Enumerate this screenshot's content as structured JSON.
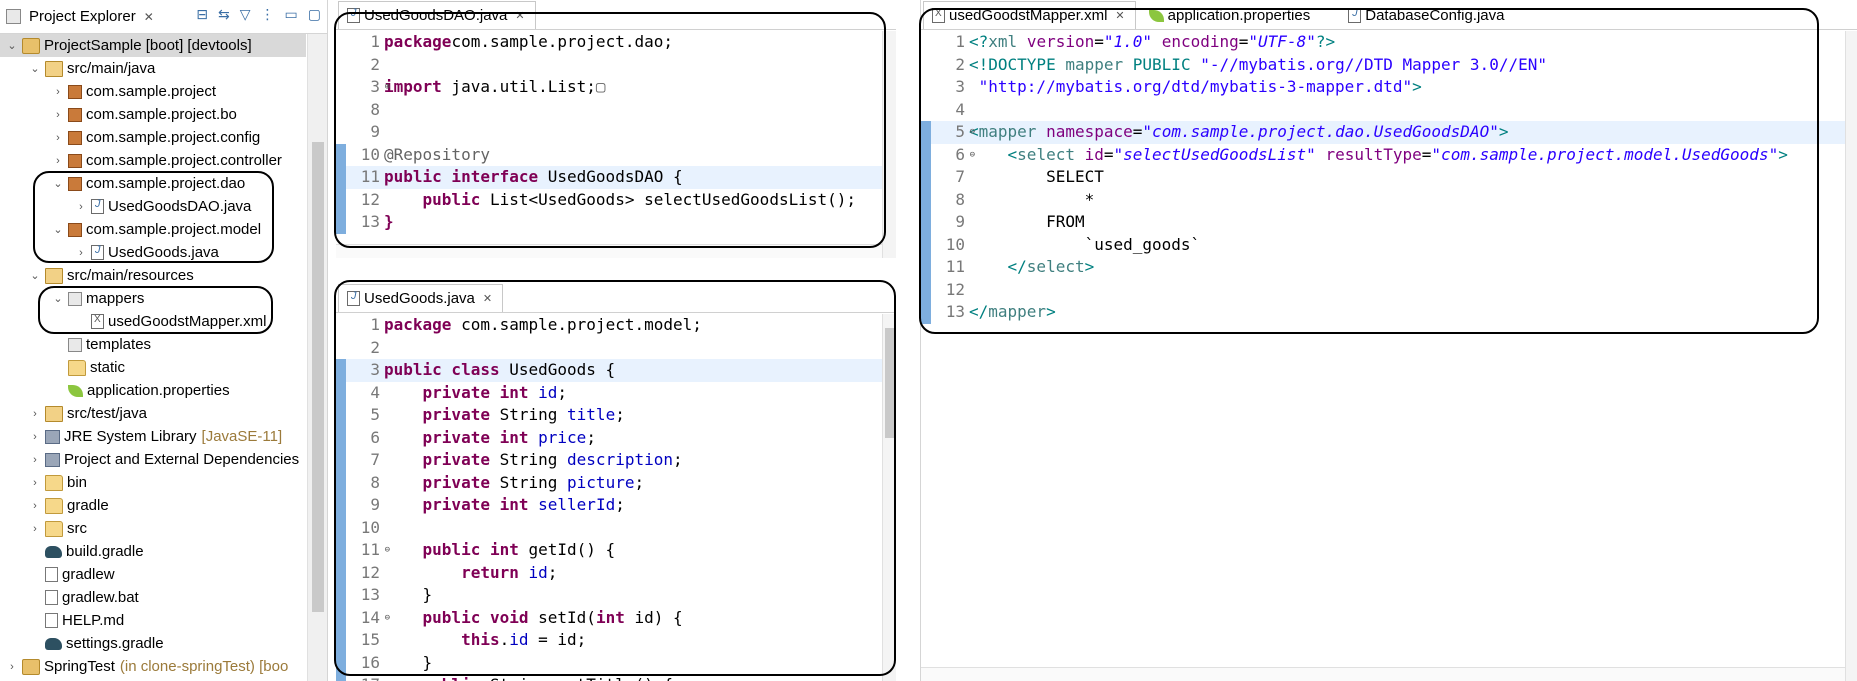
{
  "explorer": {
    "title": "Project Explorer",
    "tree": [
      {
        "label": "ProjectSample [boot] [devtools]",
        "icon": "project-icon",
        "indent": 0,
        "tw": "⌄",
        "selected": true
      },
      {
        "label": "src/main/java",
        "icon": "source-folder-icon",
        "indent": 1,
        "tw": "⌄"
      },
      {
        "label": "com.sample.project",
        "icon": "package-icon",
        "indent": 2,
        "tw": "›"
      },
      {
        "label": "com.sample.project.bo",
        "icon": "package-icon",
        "indent": 2,
        "tw": "›"
      },
      {
        "label": "com.sample.project.config",
        "icon": "package-icon",
        "indent": 2,
        "tw": "›"
      },
      {
        "label": "com.sample.project.controller",
        "icon": "package-icon",
        "indent": 2,
        "tw": "›"
      },
      {
        "label": "com.sample.project.dao",
        "icon": "package-icon",
        "indent": 2,
        "tw": "⌄"
      },
      {
        "label": "UsedGoodsDAO.java",
        "icon": "java-interface-file-icon",
        "indent": 3,
        "tw": "›"
      },
      {
        "label": "com.sample.project.model",
        "icon": "package-icon",
        "indent": 2,
        "tw": "⌄"
      },
      {
        "label": "UsedGoods.java",
        "icon": "java-file-icon",
        "indent": 3,
        "tw": "›"
      },
      {
        "label": "src/main/resources",
        "icon": "source-folder-icon",
        "indent": 1,
        "tw": "⌄"
      },
      {
        "label": "mappers",
        "icon": "folder-package-icon",
        "indent": 2,
        "tw": "⌄"
      },
      {
        "label": "usedGoodstMapper.xml",
        "icon": "xml-file-icon",
        "indent": 3,
        "tw": ""
      },
      {
        "label": "templates",
        "icon": "folder-package-icon",
        "indent": 2,
        "tw": ""
      },
      {
        "label": "static",
        "icon": "folder-icon",
        "indent": 2,
        "tw": ""
      },
      {
        "label": "application.properties",
        "icon": "properties-leaf-icon",
        "indent": 2,
        "tw": ""
      },
      {
        "label": "src/test/java",
        "icon": "source-folder-icon",
        "indent": 1,
        "tw": "›"
      },
      {
        "label": "JRE System Library",
        "suffix": "[JavaSE-11]",
        "icon": "library-icon",
        "indent": 1,
        "tw": "›"
      },
      {
        "label": "Project and External Dependencies",
        "icon": "library-icon",
        "indent": 1,
        "tw": "›"
      },
      {
        "label": "bin",
        "icon": "folder-icon",
        "indent": 1,
        "tw": "›"
      },
      {
        "label": "gradle",
        "icon": "folder-icon",
        "indent": 1,
        "tw": "›"
      },
      {
        "label": "src",
        "icon": "folder-icon",
        "indent": 1,
        "tw": "›"
      },
      {
        "label": "build.gradle",
        "icon": "gradle-elephant-icon",
        "indent": 1,
        "tw": ""
      },
      {
        "label": "gradlew",
        "icon": "file-icon",
        "indent": 1,
        "tw": ""
      },
      {
        "label": "gradlew.bat",
        "icon": "file-icon",
        "indent": 1,
        "tw": ""
      },
      {
        "label": "HELP.md",
        "icon": "markdown-file-icon",
        "indent": 1,
        "tw": ""
      },
      {
        "label": "settings.gradle",
        "icon": "gradle-elephant-icon",
        "indent": 1,
        "tw": ""
      },
      {
        "label": "SpringTest",
        "suffix": "(in clone-springTest) [boo",
        "icon": "project-icon",
        "indent": 0,
        "tw": "›"
      }
    ]
  },
  "dao_editor": {
    "tab": "UsedGoodsDAO.java",
    "lines": [
      {
        "n": "1",
        "segs": [
          [
            "kw",
            "package"
          ],
          [
            "",
            "com.sample.project.dao;"
          ]
        ]
      },
      {
        "n": "2",
        "segs": []
      },
      {
        "n": "3",
        "fold": "⊕",
        "segs": [
          [
            "kw",
            "import"
          ],
          [
            "",
            " java.util.List;"
          ],
          [
            "ann",
            "▢"
          ]
        ]
      },
      {
        "n": "8",
        "segs": []
      },
      {
        "n": "9",
        "segs": []
      },
      {
        "n": "10",
        "mark": true,
        "segs": [
          [
            "ann",
            "@Repository"
          ]
        ]
      },
      {
        "n": "11",
        "mark": true,
        "hl": true,
        "segs": [
          [
            "kw",
            "public interface"
          ],
          [
            "",
            " UsedGoodsDAO {"
          ]
        ]
      },
      {
        "n": "12",
        "mark": true,
        "segs": [
          [
            "",
            "    "
          ],
          [
            "kw",
            "public"
          ],
          [
            "",
            " List<UsedGoods> selectUsedGoodsList();"
          ]
        ]
      },
      {
        "n": "13",
        "mark": true,
        "segs": [
          [
            "kw",
            "}"
          ]
        ]
      }
    ]
  },
  "model_editor": {
    "tab": "UsedGoods.java",
    "lines": [
      {
        "n": "1",
        "segs": [
          [
            "kw",
            "package"
          ],
          [
            "",
            " com.sample.project.model;"
          ]
        ]
      },
      {
        "n": "2",
        "segs": []
      },
      {
        "n": "3",
        "mark": true,
        "hl": true,
        "segs": [
          [
            "kw",
            "public class"
          ],
          [
            "",
            " UsedGoods {"
          ]
        ]
      },
      {
        "n": "4",
        "mark": true,
        "segs": [
          [
            "",
            "    "
          ],
          [
            "kw",
            "private int"
          ],
          [
            "",
            " "
          ],
          [
            "fld",
            "id"
          ],
          [
            "",
            ";"
          ]
        ]
      },
      {
        "n": "5",
        "mark": true,
        "segs": [
          [
            "",
            "    "
          ],
          [
            "kw",
            "private"
          ],
          [
            "",
            " String "
          ],
          [
            "fld",
            "title"
          ],
          [
            "",
            ";"
          ]
        ]
      },
      {
        "n": "6",
        "mark": true,
        "segs": [
          [
            "",
            "    "
          ],
          [
            "kw",
            "private int"
          ],
          [
            "",
            " "
          ],
          [
            "fld",
            "price"
          ],
          [
            "",
            ";"
          ]
        ]
      },
      {
        "n": "7",
        "mark": true,
        "segs": [
          [
            "",
            "    "
          ],
          [
            "kw",
            "private"
          ],
          [
            "",
            " String "
          ],
          [
            "fld",
            "description"
          ],
          [
            "",
            ";"
          ]
        ]
      },
      {
        "n": "8",
        "mark": true,
        "segs": [
          [
            "",
            "    "
          ],
          [
            "kw",
            "private"
          ],
          [
            "",
            " String "
          ],
          [
            "fld",
            "picture"
          ],
          [
            "",
            ";"
          ]
        ]
      },
      {
        "n": "9",
        "mark": true,
        "segs": [
          [
            "",
            "    "
          ],
          [
            "kw",
            "private int"
          ],
          [
            "",
            " "
          ],
          [
            "fld",
            "sellerId"
          ],
          [
            "",
            ";"
          ]
        ]
      },
      {
        "n": "10",
        "mark": true,
        "segs": []
      },
      {
        "n": "11",
        "mark": true,
        "fold": "⊖",
        "segs": [
          [
            "",
            "    "
          ],
          [
            "kw",
            "public int"
          ],
          [
            "",
            " getId() {"
          ]
        ]
      },
      {
        "n": "12",
        "mark": true,
        "segs": [
          [
            "",
            "        "
          ],
          [
            "kw",
            "return"
          ],
          [
            "",
            " "
          ],
          [
            "fld",
            "id"
          ],
          [
            "",
            ";"
          ]
        ]
      },
      {
        "n": "13",
        "mark": true,
        "segs": [
          [
            "",
            "    }"
          ]
        ]
      },
      {
        "n": "14",
        "mark": true,
        "fold": "⊖",
        "segs": [
          [
            "",
            "    "
          ],
          [
            "kw",
            "public void"
          ],
          [
            "",
            " setId("
          ],
          [
            "kw",
            "int"
          ],
          [
            "",
            " id) {"
          ]
        ]
      },
      {
        "n": "15",
        "mark": true,
        "segs": [
          [
            "",
            "        "
          ],
          [
            "kw",
            "this"
          ],
          [
            "",
            "."
          ],
          [
            "fld",
            "id"
          ],
          [
            "",
            " = id;"
          ]
        ]
      },
      {
        "n": "16",
        "mark": true,
        "segs": [
          [
            "",
            "    }"
          ]
        ]
      },
      {
        "n": "17",
        "mark": true,
        "fold": "⊖",
        "segs": [
          [
            "",
            "    "
          ],
          [
            "kw",
            "public"
          ],
          [
            "",
            " String getTitle() {"
          ]
        ]
      }
    ]
  },
  "mapper_editor": {
    "tabs": [
      {
        "label": "usedGoodstMapper.xml",
        "active": true,
        "icon": "xml-file-icon",
        "closable": true
      },
      {
        "label": "application.properties",
        "active": false,
        "icon": "properties-leaf-icon"
      },
      {
        "label": "DatabaseConfig.java",
        "active": false,
        "icon": "java-file-icon"
      }
    ],
    "lines": [
      {
        "n": "1",
        "segs": [
          [
            "pi",
            "<?"
          ],
          [
            "tag",
            "xml"
          ],
          [
            "",
            " "
          ],
          [
            "attr",
            "version"
          ],
          [
            "",
            "="
          ],
          [
            "attrv",
            "\"1.0\""
          ],
          [
            "",
            " "
          ],
          [
            "attr",
            "encoding"
          ],
          [
            "",
            "="
          ],
          [
            "attrv",
            "\"UTF-8\""
          ],
          [
            "pi",
            "?>"
          ]
        ]
      },
      {
        "n": "2",
        "segs": [
          [
            "pi",
            "<!DOCTYPE"
          ],
          [
            "tag",
            " mapper"
          ],
          [
            "pi",
            " PUBLIC "
          ],
          [
            "str2",
            "\"-//mybatis.org//DTD Mapper 3.0//EN\""
          ]
        ]
      },
      {
        "n": "3",
        "segs": [
          [
            "str2",
            " \"http://mybatis.org/dtd/mybatis-3-mapper.dtd\""
          ],
          [
            "pi",
            ">"
          ]
        ]
      },
      {
        "n": "4",
        "segs": []
      },
      {
        "n": "5",
        "mark": true,
        "hl": true,
        "fold": "⊖",
        "segs": [
          [
            "pi",
            "<"
          ],
          [
            "tag",
            "mapper"
          ],
          [
            "",
            " "
          ],
          [
            "attr",
            "namespace"
          ],
          [
            "",
            "="
          ],
          [
            "attrv",
            "\"com.sample.project.dao.UsedGoodsDAO\""
          ],
          [
            "pi",
            ">"
          ]
        ]
      },
      {
        "n": "6",
        "mark": true,
        "fold": "⊖",
        "segs": [
          [
            "",
            "    "
          ],
          [
            "pi",
            "<"
          ],
          [
            "tag",
            "select"
          ],
          [
            "",
            " "
          ],
          [
            "attr",
            "id"
          ],
          [
            "",
            "="
          ],
          [
            "attrv",
            "\"selectUsedGoodsList\""
          ],
          [
            "",
            " "
          ],
          [
            "attr",
            "resultType"
          ],
          [
            "",
            "="
          ],
          [
            "attrv",
            "\"com.sample.project.model.UsedGoods\""
          ],
          [
            "pi",
            ">"
          ]
        ]
      },
      {
        "n": "7",
        "mark": true,
        "segs": [
          [
            "",
            "        SELECT"
          ]
        ]
      },
      {
        "n": "8",
        "mark": true,
        "segs": [
          [
            "",
            "            *"
          ]
        ]
      },
      {
        "n": "9",
        "mark": true,
        "segs": [
          [
            "",
            "        FROM"
          ]
        ]
      },
      {
        "n": "10",
        "mark": true,
        "segs": [
          [
            "",
            "            `used_goods`"
          ]
        ]
      },
      {
        "n": "11",
        "mark": true,
        "segs": [
          [
            "",
            "    "
          ],
          [
            "pi",
            "</"
          ],
          [
            "tag",
            "select"
          ],
          [
            "pi",
            ">"
          ]
        ]
      },
      {
        "n": "12",
        "mark": true,
        "segs": []
      },
      {
        "n": "13",
        "mark": true,
        "segs": [
          [
            "pi",
            "</"
          ],
          [
            "tag",
            "mapper"
          ],
          [
            "pi",
            ">"
          ]
        ]
      }
    ]
  }
}
